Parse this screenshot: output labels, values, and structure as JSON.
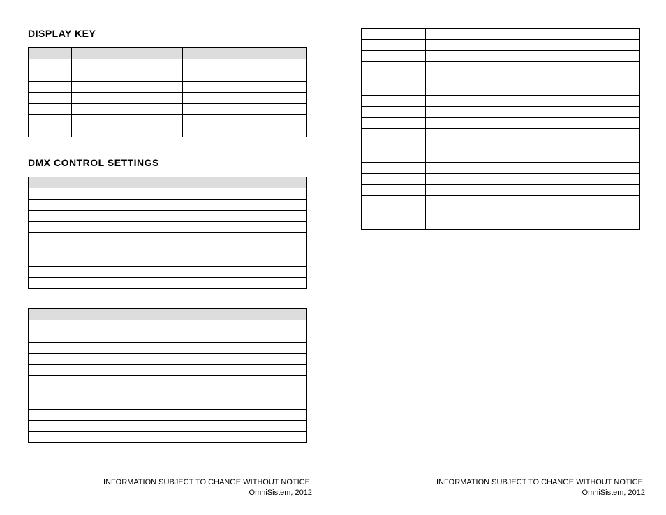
{
  "left": {
    "heading1": "DISPLAY KEY",
    "heading2": "DMX CONTROL SETTINGS",
    "table1": {
      "cols": 3,
      "headerRow": true,
      "rows": 8
    },
    "table2": {
      "cols": 2,
      "headerRow": true,
      "rows": 10
    },
    "table3": {
      "cols": 2,
      "headerRow": true,
      "rows": 12
    }
  },
  "right": {
    "table4": {
      "cols": 2,
      "headerRow": false,
      "rows": 18
    }
  },
  "footer": {
    "line1": "INFORMATION SUBJECT TO CHANGE WITHOUT NOTICE.",
    "line2": "OmniSistem, 2012"
  }
}
